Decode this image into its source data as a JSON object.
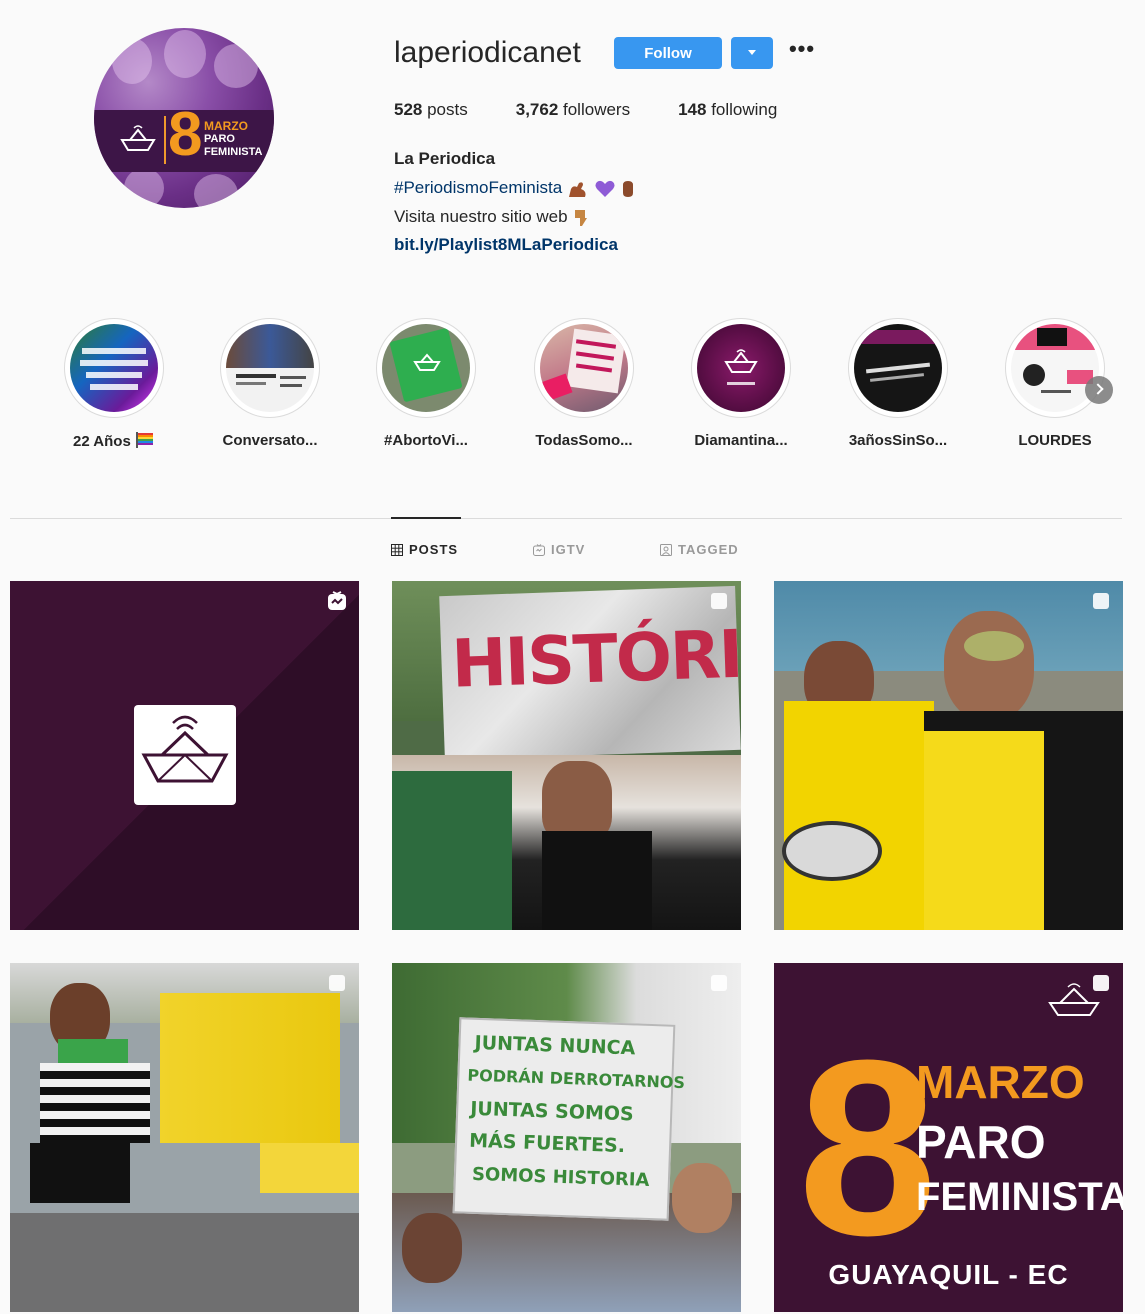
{
  "profile": {
    "username": "laperiodicanet",
    "follow_label": "Follow",
    "more_label": "•••",
    "stats": {
      "posts_count": "528",
      "posts_label": " posts",
      "followers_count": "3,762",
      "followers_label": " followers",
      "following_count": "148",
      "following_label": " following"
    },
    "full_name": "La Periodica",
    "bio": {
      "hashtag": "#PeriodismoFeminista",
      "line2": "Visita nuestro sitio web",
      "link": "bit.ly/Playlist8MLaPeriodica"
    },
    "avatar": {
      "number": "8",
      "line1": "MARZO",
      "line2": "PARO",
      "line3": "FEMINISTA"
    }
  },
  "highlights": [
    {
      "label": "22 Años"
    },
    {
      "label": "Conversato..."
    },
    {
      "label": "#AbortoVi..."
    },
    {
      "label": "TodasSomo..."
    },
    {
      "label": "Diamantina..."
    },
    {
      "label": "3añosSinSo..."
    },
    {
      "label": "LOURDES"
    }
  ],
  "tabs": [
    {
      "label": "POSTS",
      "icon": "grid-icon",
      "active": true
    },
    {
      "label": "IGTV",
      "icon": "igtv-icon",
      "active": false
    },
    {
      "label": "TAGGED",
      "icon": "tagged-icon",
      "active": false
    }
  ],
  "posts": [
    {
      "kind": "igtv",
      "icon": "igtv-icon"
    },
    {
      "kind": "carousel",
      "icon": "carousel-icon",
      "sign": "HISTÓRICA"
    },
    {
      "kind": "carousel",
      "icon": "carousel-icon"
    },
    {
      "kind": "carousel",
      "icon": "carousel-icon"
    },
    {
      "kind": "carousel",
      "icon": "carousel-icon",
      "sign_lines": [
        "JUNTAS NUNCA",
        "PODRÁN DERROTARNOS",
        "JUNTAS SOMOS",
        "MÁS  FUERTES.",
        "SOMOS  HISTORIA"
      ]
    },
    {
      "kind": "carousel",
      "icon": "carousel-icon",
      "poster": {
        "number": "8",
        "line1": "MARZO",
        "line2": "PARO",
        "line3": "FEMINISTA",
        "city": "GUAYAQUIL - EC"
      }
    }
  ],
  "colors": {
    "accent_blue": "#3897f0",
    "link_dark": "#003569",
    "brand_purple": "#3d1233",
    "brand_orange": "#f39a1f"
  }
}
